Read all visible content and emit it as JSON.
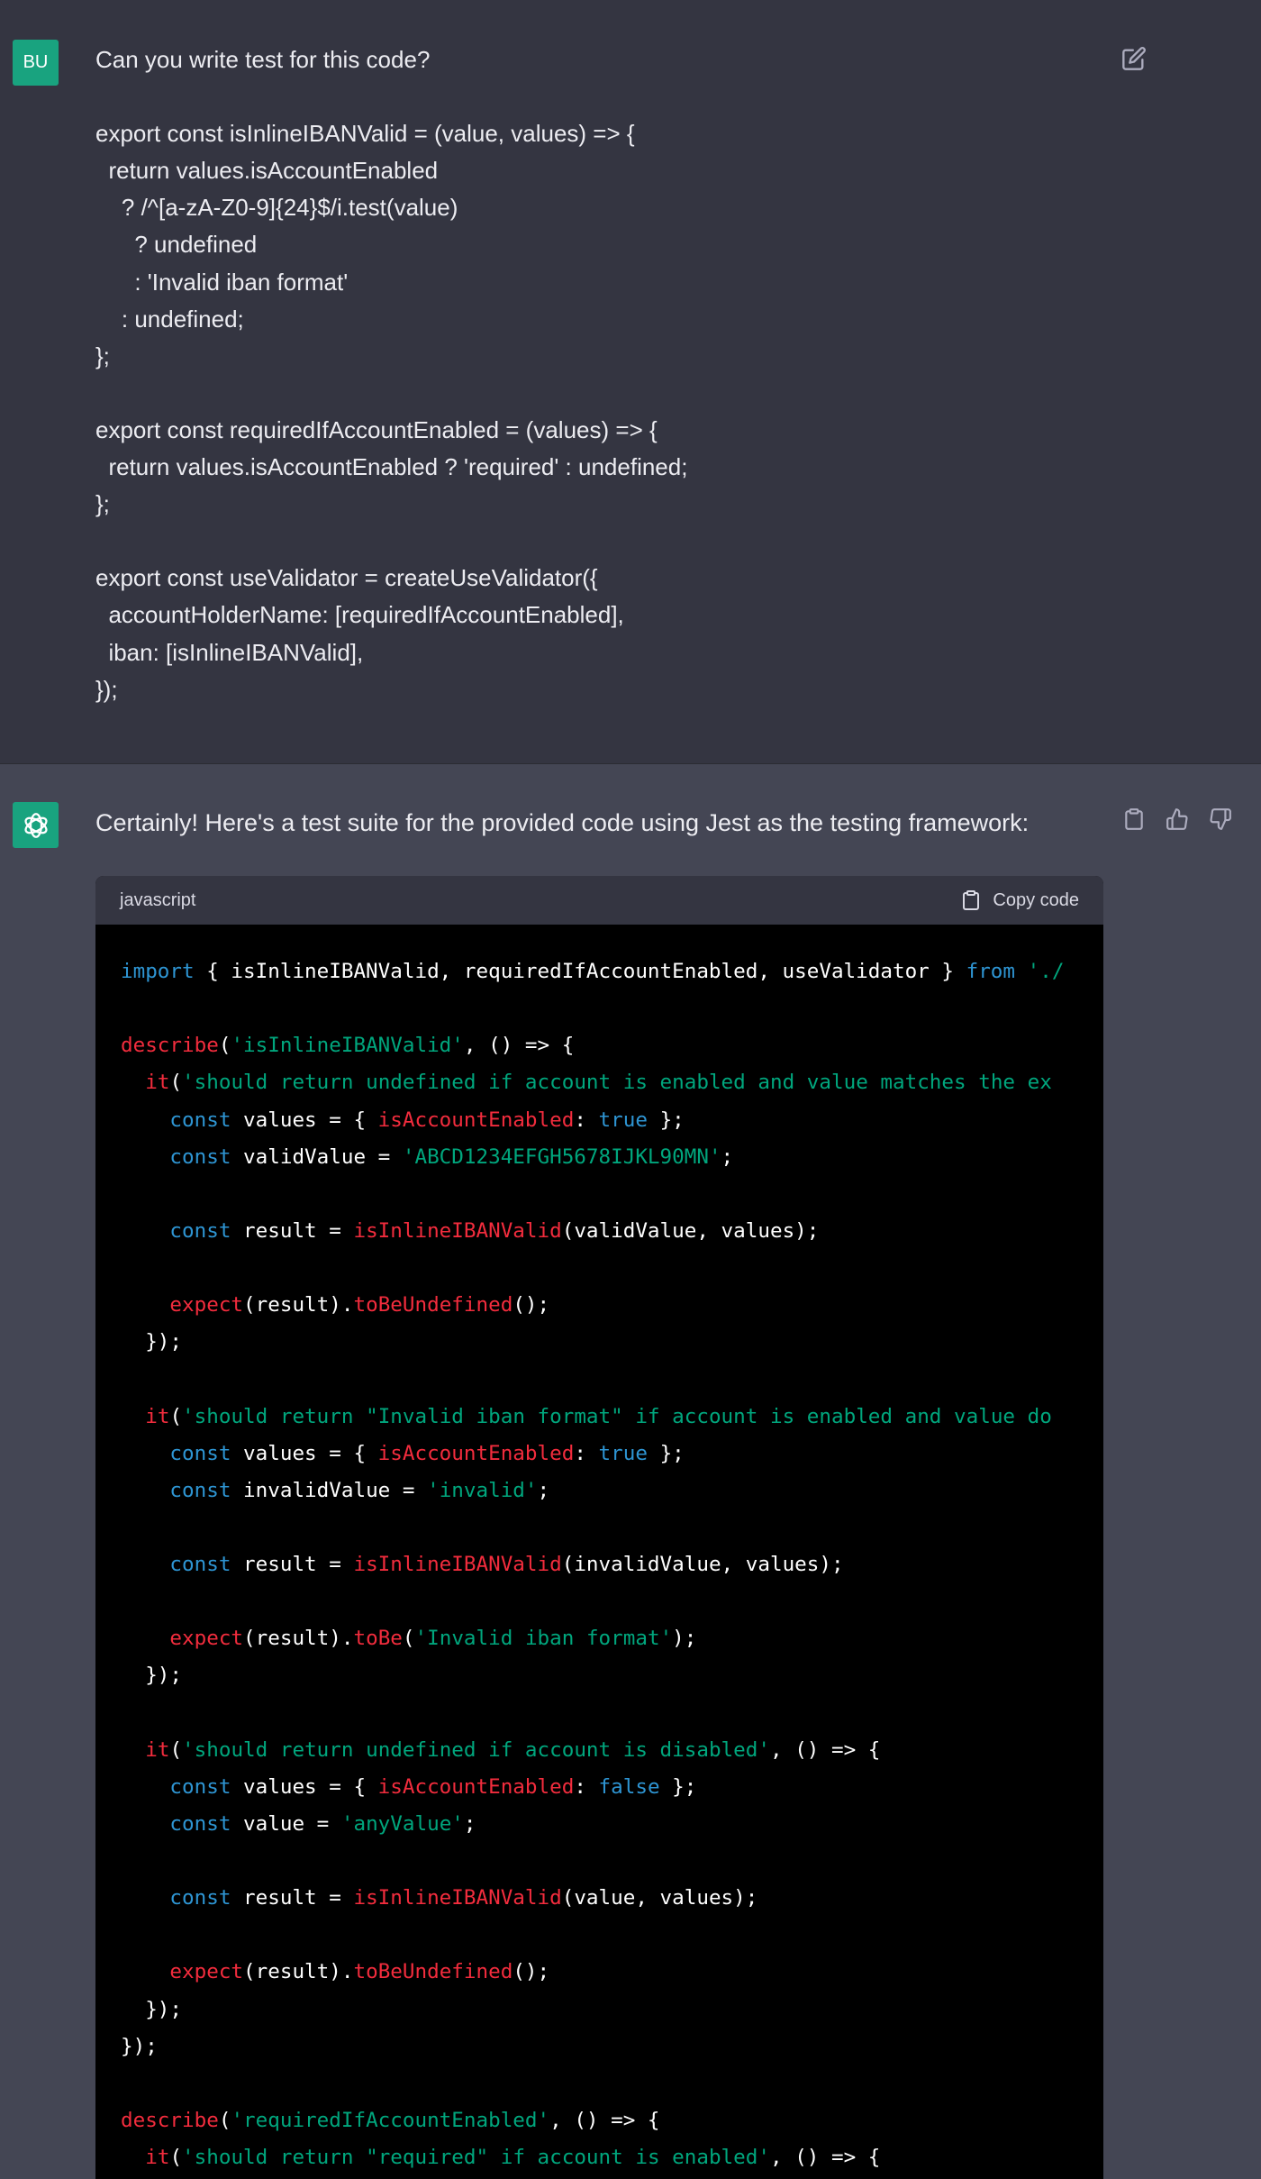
{
  "user_message": {
    "avatar_initials": "BU",
    "lines": [
      "Can you write test for this code?",
      "",
      "export const isInlineIBANValid = (value, values) => {",
      "  return values.isAccountEnabled",
      "    ? /^[a-zA-Z0-9]{24}$/i.test(value)",
      "      ? undefined",
      "      : 'Invalid iban format'",
      "    : undefined;",
      "};",
      "",
      "export const requiredIfAccountEnabled = (values) => {",
      "  return values.isAccountEnabled ? 'required' : undefined;",
      "};",
      "",
      "export const useValidator = createUseValidator({",
      "  accountHolderName: [requiredIfAccountEnabled],",
      "  iban: [isInlineIBANValid],",
      "});"
    ],
    "edit_icon": "edit-icon"
  },
  "assistant_message": {
    "avatar_icon": "openai-logo-icon",
    "intro_text": "Certainly! Here's a test suite for the provided code using Jest as the testing framework:",
    "actions": [
      "clipboard-icon",
      "thumbs-up-icon",
      "thumbs-down-icon"
    ],
    "code_block": {
      "language": "javascript",
      "copy_label": "Copy code",
      "lines": [
        [
          [
            "kw",
            "import"
          ],
          [
            "p",
            " { isInlineIBANValid, requiredIfAccountEnabled, useValidator } "
          ],
          [
            "kw",
            "from"
          ],
          [
            "p",
            " "
          ],
          [
            "str",
            "'./"
          ]
        ],
        [],
        [
          [
            "fn",
            "describe"
          ],
          [
            "p",
            "("
          ],
          [
            "str",
            "'isInlineIBANValid'"
          ],
          [
            "p",
            ", () => {"
          ]
        ],
        [
          [
            "p",
            "  "
          ],
          [
            "fn",
            "it"
          ],
          [
            "p",
            "("
          ],
          [
            "str",
            "'should return undefined if account is enabled and value matches the ex"
          ]
        ],
        [
          [
            "p",
            "    "
          ],
          [
            "kw",
            "const"
          ],
          [
            "p",
            " values = { "
          ],
          [
            "fn",
            "isAccountEnabled"
          ],
          [
            "p",
            ": "
          ],
          [
            "kw",
            "true"
          ],
          [
            "p",
            " };"
          ]
        ],
        [
          [
            "p",
            "    "
          ],
          [
            "kw",
            "const"
          ],
          [
            "p",
            " validValue = "
          ],
          [
            "str",
            "'ABCD1234EFGH5678IJKL90MN'"
          ],
          [
            "p",
            ";"
          ]
        ],
        [],
        [
          [
            "p",
            "    "
          ],
          [
            "kw",
            "const"
          ],
          [
            "p",
            " result = "
          ],
          [
            "fn",
            "isInlineIBANValid"
          ],
          [
            "p",
            "(validValue, values);"
          ]
        ],
        [],
        [
          [
            "p",
            "    "
          ],
          [
            "fn",
            "expect"
          ],
          [
            "p",
            "(result)."
          ],
          [
            "fn",
            "toBeUndefined"
          ],
          [
            "p",
            "();"
          ]
        ],
        [
          [
            "p",
            "  });"
          ]
        ],
        [],
        [
          [
            "p",
            "  "
          ],
          [
            "fn",
            "it"
          ],
          [
            "p",
            "("
          ],
          [
            "str",
            "'should return \"Invalid iban format\" if account is enabled and value do"
          ]
        ],
        [
          [
            "p",
            "    "
          ],
          [
            "kw",
            "const"
          ],
          [
            "p",
            " values = { "
          ],
          [
            "fn",
            "isAccountEnabled"
          ],
          [
            "p",
            ": "
          ],
          [
            "kw",
            "true"
          ],
          [
            "p",
            " };"
          ]
        ],
        [
          [
            "p",
            "    "
          ],
          [
            "kw",
            "const"
          ],
          [
            "p",
            " invalidValue = "
          ],
          [
            "str",
            "'invalid'"
          ],
          [
            "p",
            ";"
          ]
        ],
        [],
        [
          [
            "p",
            "    "
          ],
          [
            "kw",
            "const"
          ],
          [
            "p",
            " result = "
          ],
          [
            "fn",
            "isInlineIBANValid"
          ],
          [
            "p",
            "(invalidValue, values);"
          ]
        ],
        [],
        [
          [
            "p",
            "    "
          ],
          [
            "fn",
            "expect"
          ],
          [
            "p",
            "(result)."
          ],
          [
            "fn",
            "toBe"
          ],
          [
            "p",
            "("
          ],
          [
            "str",
            "'Invalid iban format'"
          ],
          [
            "p",
            ");"
          ]
        ],
        [
          [
            "p",
            "  });"
          ]
        ],
        [],
        [
          [
            "p",
            "  "
          ],
          [
            "fn",
            "it"
          ],
          [
            "p",
            "("
          ],
          [
            "str",
            "'should return undefined if account is disabled'"
          ],
          [
            "p",
            ", () => {"
          ]
        ],
        [
          [
            "p",
            "    "
          ],
          [
            "kw",
            "const"
          ],
          [
            "p",
            " values = { "
          ],
          [
            "fn",
            "isAccountEnabled"
          ],
          [
            "p",
            ": "
          ],
          [
            "kw",
            "false"
          ],
          [
            "p",
            " };"
          ]
        ],
        [
          [
            "p",
            "    "
          ],
          [
            "kw",
            "const"
          ],
          [
            "p",
            " value = "
          ],
          [
            "str",
            "'anyValue'"
          ],
          [
            "p",
            ";"
          ]
        ],
        [],
        [
          [
            "p",
            "    "
          ],
          [
            "kw",
            "const"
          ],
          [
            "p",
            " result = "
          ],
          [
            "fn",
            "isInlineIBANValid"
          ],
          [
            "p",
            "(value, values);"
          ]
        ],
        [],
        [
          [
            "p",
            "    "
          ],
          [
            "fn",
            "expect"
          ],
          [
            "p",
            "(result)."
          ],
          [
            "fn",
            "toBeUndefined"
          ],
          [
            "p",
            "();"
          ]
        ],
        [
          [
            "p",
            "  });"
          ]
        ],
        [
          [
            "p",
            "});"
          ]
        ],
        [],
        [
          [
            "fn",
            "describe"
          ],
          [
            "p",
            "("
          ],
          [
            "str",
            "'requiredIfAccountEnabled'"
          ],
          [
            "p",
            ", () => {"
          ]
        ],
        [
          [
            "p",
            "  "
          ],
          [
            "fn",
            "it"
          ],
          [
            "p",
            "("
          ],
          [
            "str",
            "'should return \"required\" if account is enabled'"
          ],
          [
            "p",
            ", () => {"
          ]
        ]
      ]
    }
  },
  "colors": {
    "user_bg": "#343541",
    "assistant_bg": "#444654",
    "avatar_bg": "#19a37f",
    "code_keyword": "#2e95d3",
    "code_function": "#f22c3d",
    "code_string": "#00a67d"
  }
}
